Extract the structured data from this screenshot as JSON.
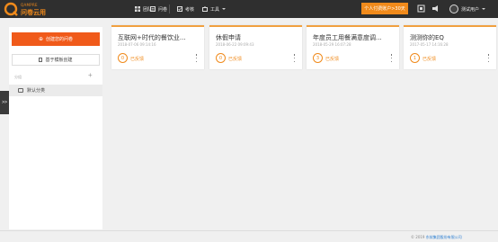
{
  "brand": {
    "name_en": "QAMPRE",
    "name_cn": "问卷云用",
    "accent_color": "#f08a1b"
  },
  "nav": {
    "team": "团队",
    "survey": "问卷",
    "exam": "考核",
    "tools": "工具"
  },
  "header": {
    "upgrade_label": "个人付费账户>30天",
    "user_name": "测试用户"
  },
  "sidebar": {
    "create_label": "创建您的问卷",
    "template_label": "基于模板创建",
    "category_header": "分组",
    "categories": [
      "默认分类"
    ],
    "toggle_label": ">>"
  },
  "cards": [
    {
      "title": "互联网+时代的餐饮业...",
      "date": "2018-07-06 09:14:16",
      "count": "0",
      "status": "已反馈"
    },
    {
      "title": "休假申请",
      "date": "2018-06-22 09:09:43",
      "count": "0",
      "status": "已反馈"
    },
    {
      "title": "年度员工用餐满意度调...",
      "date": "2018-05-29 16:07:28",
      "count": "3",
      "status": "已反馈"
    },
    {
      "title": "测测你的EQ",
      "date": "2017-05-17 14:16:28",
      "count": "1",
      "status": "已反馈"
    }
  ],
  "footer": {
    "copyright": "© 2019 ",
    "company": "东软集团股份有限公司"
  }
}
